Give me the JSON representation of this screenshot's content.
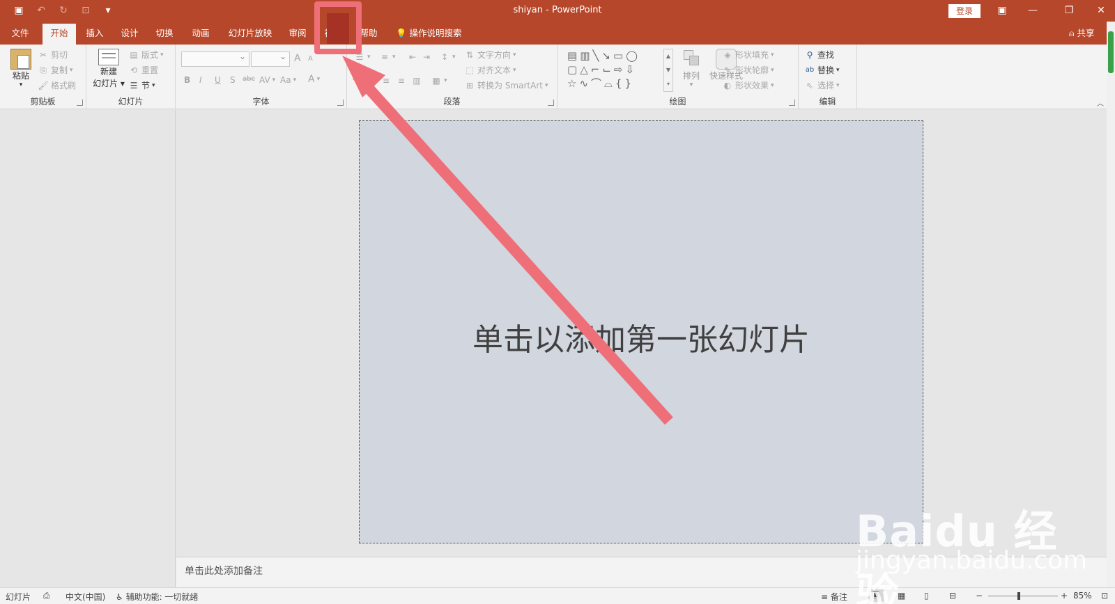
{
  "titlebar": {
    "title": "shiyan  -  PowerPoint",
    "login": "登录",
    "controls": {
      "ribbon_display": "▣",
      "minimize": "—",
      "restore": "❐",
      "close": "✕"
    },
    "qat": {
      "save": "▣",
      "undo": "↶",
      "redo": "↻",
      "start": "⊡",
      "customize": "▾"
    }
  },
  "tabs": [
    {
      "label": "文件"
    },
    {
      "label": "开始"
    },
    {
      "label": "插入"
    },
    {
      "label": "设计"
    },
    {
      "label": "切换"
    },
    {
      "label": "动画"
    },
    {
      "label": "幻灯片放映"
    },
    {
      "label": "审阅"
    },
    {
      "label": "视图"
    },
    {
      "label": "帮助"
    }
  ],
  "tellme": "操作说明搜索",
  "share": "共享",
  "ribbon": {
    "clipboard": {
      "label": "剪贴板",
      "paste": "粘贴",
      "cut": "剪切",
      "copy": "复制",
      "format_painter": "格式刷"
    },
    "slides": {
      "label": "幻灯片",
      "new_slide_line1": "新建",
      "new_slide_line2": "幻灯片",
      "layout": "版式",
      "reset": "重置",
      "section": "节"
    },
    "font": {
      "label": "字体",
      "bold": "B",
      "italic": "I",
      "underline": "U",
      "shadow": "S",
      "strike": "abc",
      "spacing": "AV",
      "case": "Aa",
      "color": "A",
      "grow": "A",
      "shrink": "A"
    },
    "paragraph": {
      "label": "段落",
      "text_direction": "文字方向",
      "align_text": "对齐文本",
      "smartart": "转换为 SmartArt"
    },
    "drawing": {
      "label": "绘图",
      "arrange": "排列",
      "quick_styles": "快速样式",
      "shape_fill": "形状填充",
      "shape_outline": "形状轮廓",
      "shape_effects": "形状效果"
    },
    "editing": {
      "label": "编辑",
      "find": "查找",
      "replace": "替换",
      "select": "选择"
    }
  },
  "slide": {
    "placeholder": "单击以添加第一张幻灯片"
  },
  "notes": {
    "placeholder": "单击此处添加备注"
  },
  "statusbar": {
    "slide": "幻灯片",
    "language": "中文(中国)",
    "accessibility": "辅助功能: 一切就绪",
    "notes": "备注",
    "zoom": "85%"
  },
  "watermark": {
    "main": "Baidu 经验",
    "sub": "jingyan.baidu.com"
  },
  "colors": {
    "accent": "#b7472a",
    "annotation": "#ef6f78",
    "slide_bg": "#d1d6df"
  }
}
